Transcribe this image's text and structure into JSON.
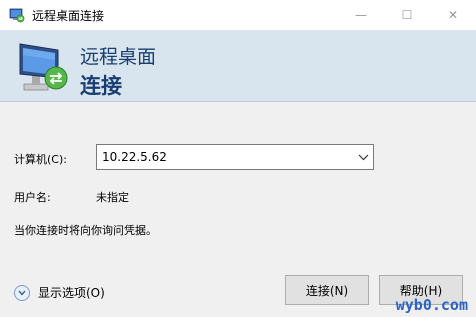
{
  "window": {
    "title": "远程桌面连接",
    "controls": {
      "minimize": "—",
      "maximize": "☐",
      "close": "✕"
    }
  },
  "header": {
    "line1": "远程桌面",
    "line2": "连接"
  },
  "form": {
    "computer_label": "计算机(C):",
    "computer_value": "10.22.5.62",
    "username_label": "用户名:",
    "username_value": "未指定",
    "credentials_note": "当你连接时将向你询问凭据。"
  },
  "footer": {
    "show_options_label": "显示选项(O)",
    "connect_label": "连接(N)",
    "help_label": "帮助(H)"
  },
  "watermark": "wyb0.com",
  "colors": {
    "header_bg": "#d8e4ee",
    "header_text": "#1a3e72",
    "watermark": "#2b63c9"
  }
}
